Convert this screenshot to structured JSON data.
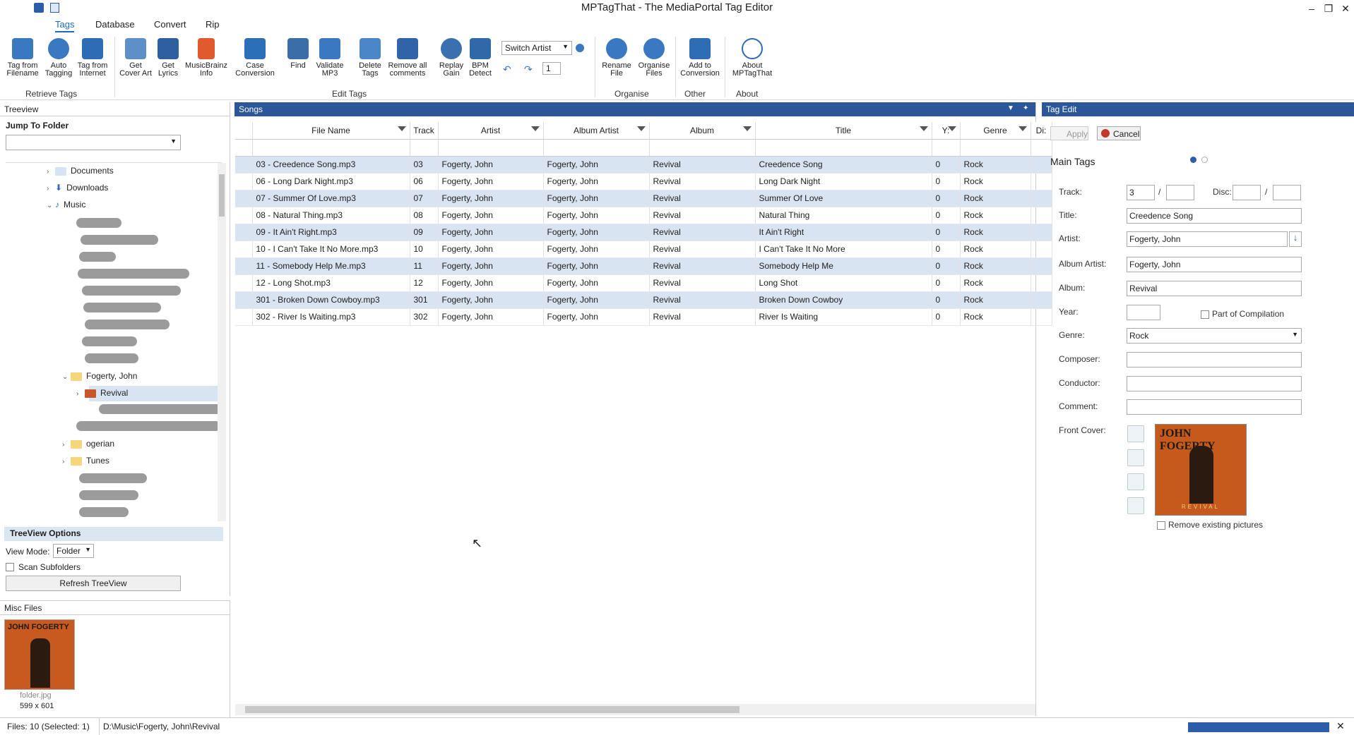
{
  "window": {
    "title": "MPTagThat - The MediaPortal Tag Editor",
    "minimize": "–",
    "restore": "❐",
    "close": "✕"
  },
  "menu_tabs": [
    "Tags",
    "Database",
    "Convert",
    "Rip"
  ],
  "ribbon": {
    "retrieve_tags": {
      "label": "Retrieve Tags",
      "buttons": [
        [
          "Tag from",
          "Filename"
        ],
        [
          "Auto",
          "Tagging"
        ],
        [
          "Tag from",
          "Internet"
        ]
      ]
    },
    "edit_tags": {
      "label": "Edit Tags",
      "buttons": [
        [
          "Get",
          "Cover Art"
        ],
        [
          "Get",
          "Lyrics"
        ],
        [
          "MusicBrainz",
          "Info"
        ],
        [
          "Case",
          "Conversion"
        ],
        [
          "Find",
          ""
        ],
        [
          "Validate",
          "MP3"
        ],
        [
          "Delete",
          "Tags"
        ],
        [
          "Remove all",
          "comments"
        ],
        [
          "Replay",
          "Gain"
        ],
        [
          "BPM",
          "Detect"
        ]
      ],
      "switch_select": "Switch Artist",
      "number_value": "1"
    },
    "organise": {
      "label": "Organise",
      "buttons": [
        [
          "Rename",
          "File"
        ],
        [
          "Organise",
          "Files"
        ]
      ]
    },
    "other": {
      "label": "Other",
      "buttons": [
        [
          "Add to",
          "Conversion"
        ]
      ]
    },
    "about": {
      "label": "About",
      "buttons": [
        [
          "About",
          "MPTagThat"
        ]
      ]
    }
  },
  "treeview": {
    "title": "Treeview",
    "jump_to_folder": "Jump To Folder",
    "items": {
      "documents": "Documents",
      "downloads": "Downloads",
      "music": "Music",
      "fogerty": "Fogerty, John",
      "revival": "Revival",
      "partial_1": "ogerian",
      "partial_2": "Tunes"
    },
    "options_title": "TreeView Options",
    "view_mode_label": "View Mode:",
    "view_mode_value": "Folder",
    "scan_subfolders": "Scan Subfolders",
    "refresh": "Refresh TreeView"
  },
  "misc_files": {
    "title": "Misc Files",
    "file_name": "folder.jpg",
    "dimensions": "599 x 601"
  },
  "songs": {
    "title": "Songs",
    "columns": [
      "File Name",
      "Track",
      "Artist",
      "Album Artist",
      "Album",
      "Title",
      "Y:",
      "Genre",
      "Di:"
    ],
    "rows": [
      [
        "03 - Creedence Song.mp3",
        "03",
        "Fogerty, John",
        "Fogerty, John",
        "Revival",
        "Creedence Song",
        "0",
        "Rock"
      ],
      [
        "06 - Long Dark Night.mp3",
        "06",
        "Fogerty, John",
        "Fogerty, John",
        "Revival",
        "Long Dark Night",
        "0",
        "Rock"
      ],
      [
        "07 - Summer Of Love.mp3",
        "07",
        "Fogerty, John",
        "Fogerty, John",
        "Revival",
        "Summer Of Love",
        "0",
        "Rock"
      ],
      [
        "08 - Natural Thing.mp3",
        "08",
        "Fogerty, John",
        "Fogerty, John",
        "Revival",
        "Natural Thing",
        "0",
        "Rock"
      ],
      [
        "09 - It Ain't Right.mp3",
        "09",
        "Fogerty, John",
        "Fogerty, John",
        "Revival",
        "It Ain't Right",
        "0",
        "Rock"
      ],
      [
        "10 - I Can't Take It No More.mp3",
        "10",
        "Fogerty, John",
        "Fogerty, John",
        "Revival",
        "I Can't Take It No More",
        "0",
        "Rock"
      ],
      [
        "11 - Somebody Help Me.mp3",
        "11",
        "Fogerty, John",
        "Fogerty, John",
        "Revival",
        "Somebody Help Me",
        "0",
        "Rock"
      ],
      [
        "12 - Long Shot.mp3",
        "12",
        "Fogerty, John",
        "Fogerty, John",
        "Revival",
        "Long Shot",
        "0",
        "Rock"
      ],
      [
        "301 - Broken Down Cowboy.mp3",
        "301",
        "Fogerty, John",
        "Fogerty, John",
        "Revival",
        "Broken Down Cowboy",
        "0",
        "Rock"
      ],
      [
        "302 - River Is Waiting.mp3",
        "302",
        "Fogerty, John",
        "Fogerty, John",
        "Revival",
        "River Is Waiting",
        "0",
        "Rock"
      ]
    ]
  },
  "tag_edit": {
    "title": "Tag Edit",
    "apply": "Apply",
    "cancel": "Cancel",
    "section": "Main Tags",
    "labels": {
      "track": "Track:",
      "disc": "Disc:",
      "title": "Title:",
      "artist": "Artist:",
      "album_artist": "Album Artist:",
      "album": "Album:",
      "year": "Year:",
      "compilation": "Part of Compilation",
      "genre": "Genre:",
      "composer": "Composer:",
      "conductor": "Conductor:",
      "comment": "Comment:",
      "front_cover": "Front Cover:",
      "remove_pictures": "Remove existing pictures"
    },
    "values": {
      "track": "3",
      "title": "Creedence Song",
      "artist": "Fogerty, John",
      "album_artist": "Fogerty, John",
      "album": "Revival",
      "genre": "Rock"
    },
    "cover_text_top": "JOHN FOGERTY",
    "cover_text_bottom": "REVIVAL"
  },
  "status": {
    "files": "Files: 10 (Selected: 1)",
    "path": "D:\\Music\\Fogerty, John\\Revival"
  }
}
